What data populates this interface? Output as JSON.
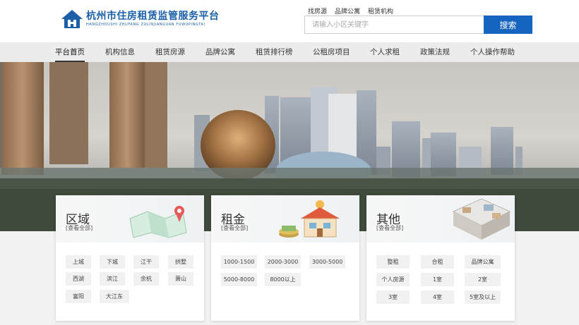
{
  "logo": {
    "title": "杭州市住房租赁监管服务平台",
    "subtitle": "HANGZHOUSHI ZHUFANG ZULINJIANGUAN FUWUPINGTAI"
  },
  "toplinks": [
    "找房源",
    "品牌公寓",
    "租赁机构"
  ],
  "search": {
    "placeholder": "请输入小区关键字",
    "button": "搜索"
  },
  "nav": [
    "平台首页",
    "机构信息",
    "租赁房源",
    "品牌公寓",
    "租赁排行榜",
    "公租房项目",
    "个人求租",
    "政策法规",
    "个人操作帮助"
  ],
  "cards": {
    "region": {
      "title": "区域",
      "viewall": "[查看全部]",
      "tags": [
        "上城",
        "下城",
        "江干",
        "拱墅",
        "西湖",
        "滨江",
        "余杭",
        "萧山",
        "富阳",
        "大江东"
      ]
    },
    "rent": {
      "title": "租金",
      "viewall": "[查看全部]",
      "tags": [
        "1000-1500",
        "2000-3000",
        "3000-5000",
        "5000-8000",
        "8000以上"
      ]
    },
    "other": {
      "title": "其他",
      "viewall": "[查看全部]",
      "tags": [
        "整租",
        "合租",
        "品牌公寓",
        "个人房源",
        "1室",
        "2室",
        "3室",
        "4室",
        "5室及以上"
      ]
    }
  }
}
